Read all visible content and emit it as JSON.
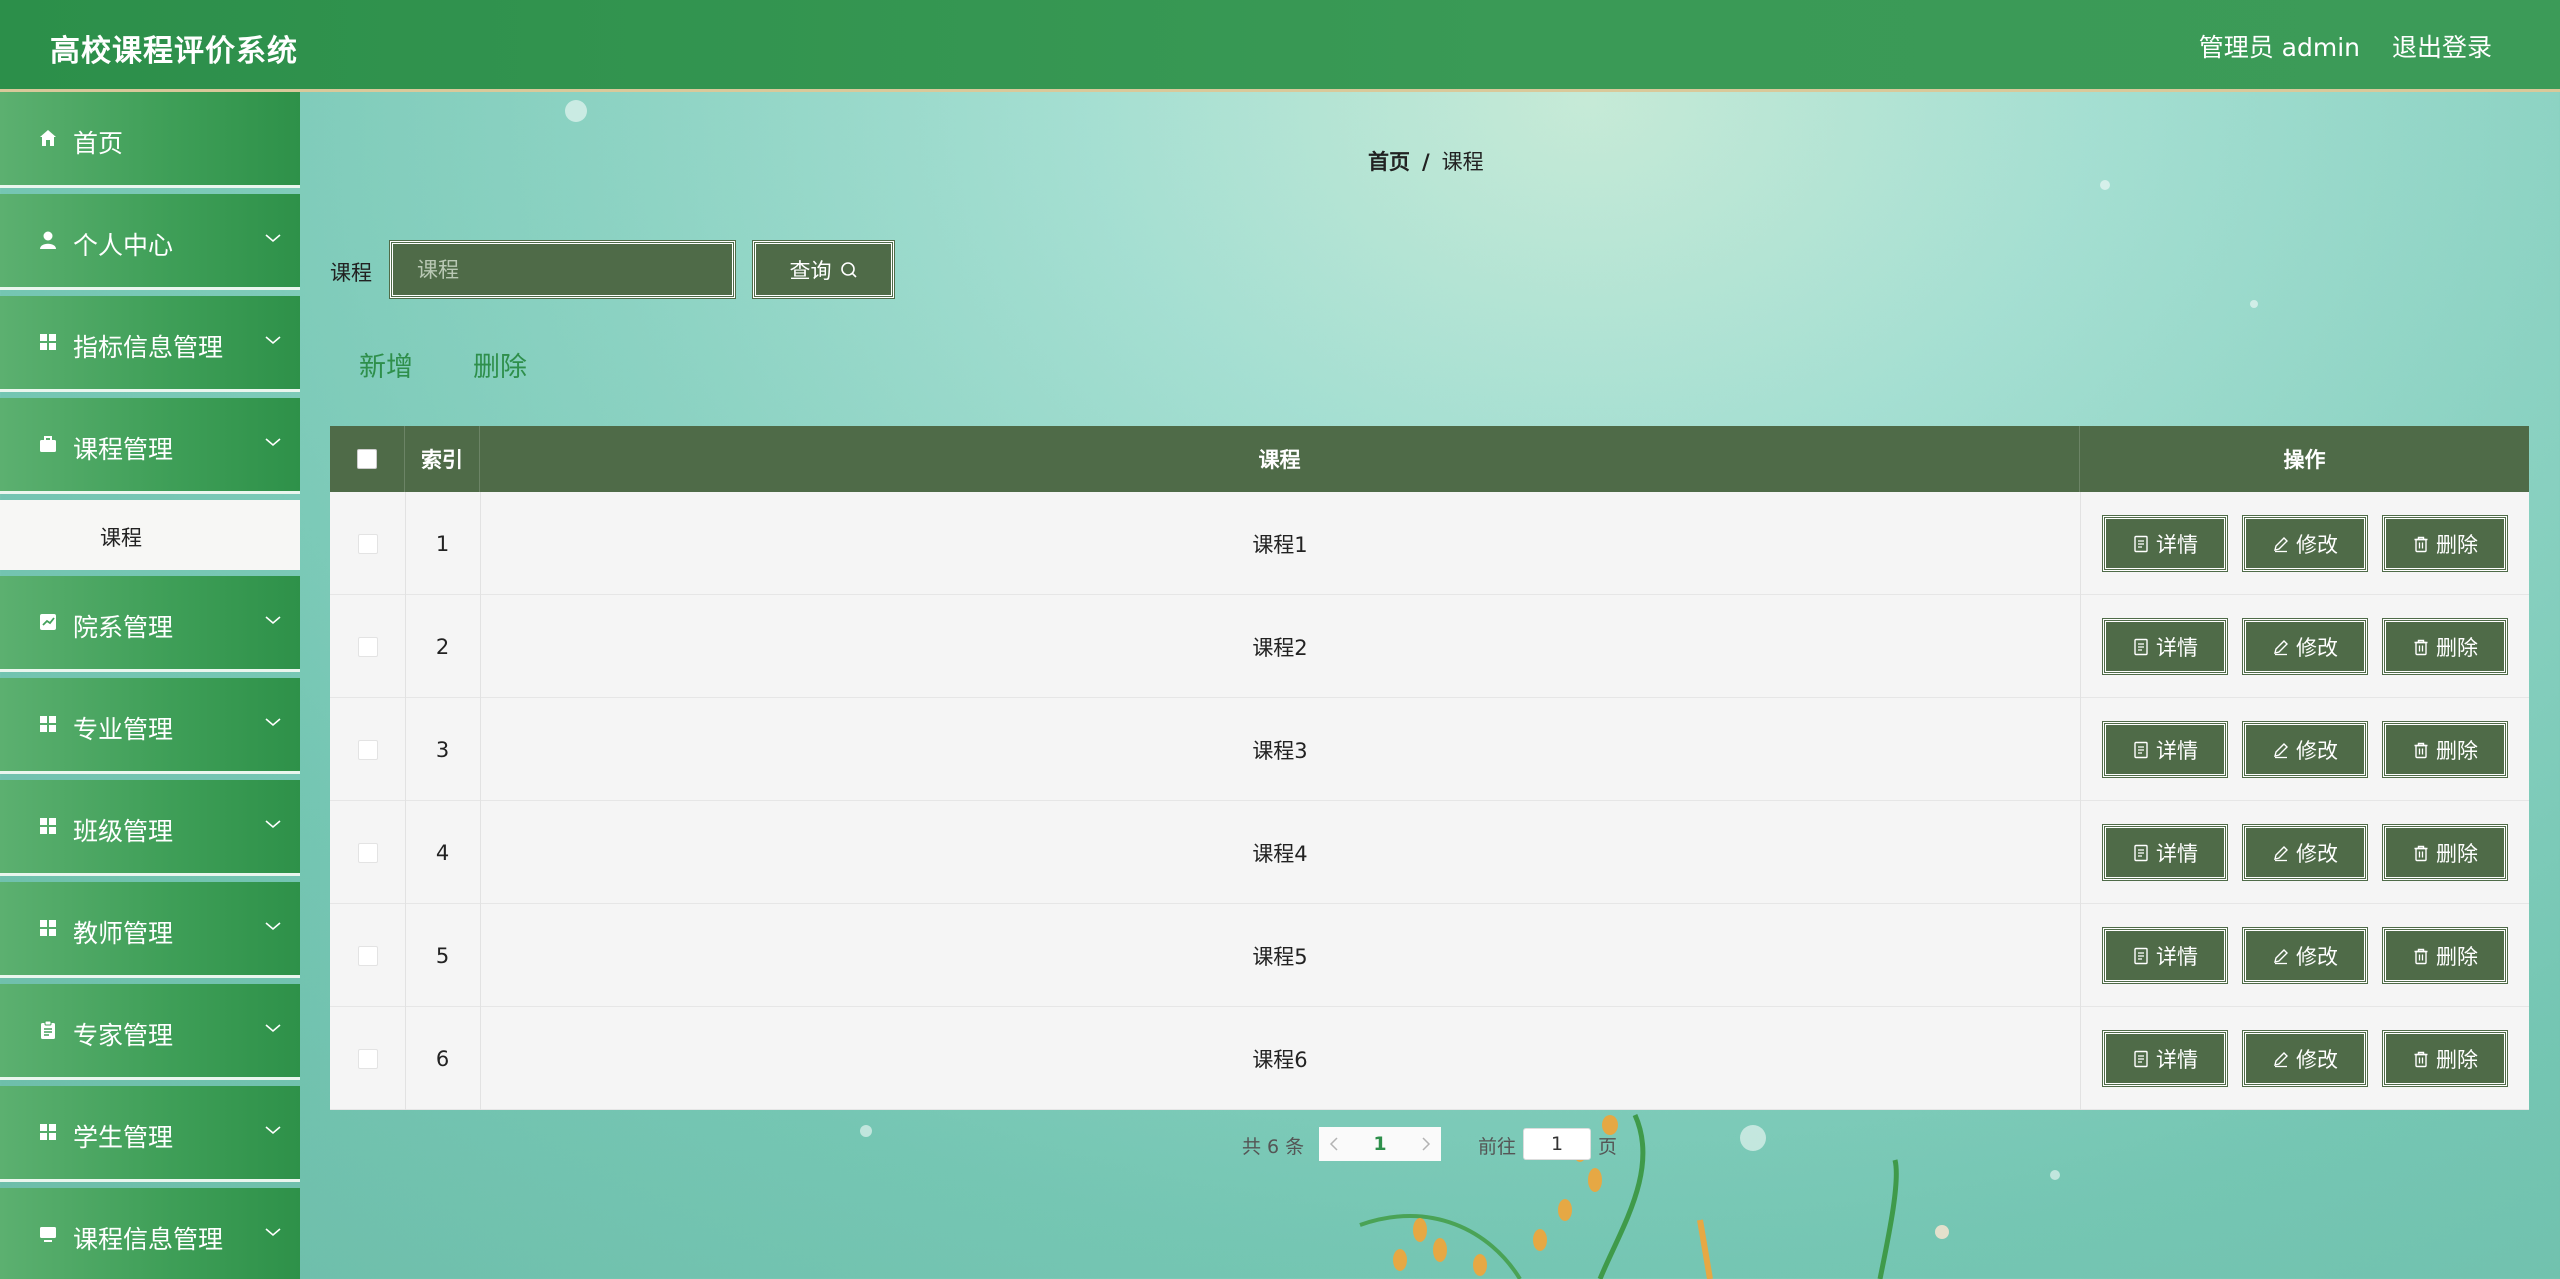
{
  "app": {
    "title": "高校课程评价系统",
    "user": "管理员 admin",
    "logout": "退出登录"
  },
  "sidebar": {
    "items": [
      {
        "label": "首页",
        "icon": "home-icon",
        "has_arrow": false
      },
      {
        "label": "个人中心",
        "icon": "user-icon",
        "has_arrow": true
      },
      {
        "label": "指标信息管理",
        "icon": "grid-icon",
        "has_arrow": true
      },
      {
        "label": "课程管理",
        "icon": "briefcase-icon",
        "has_arrow": true,
        "submenu": "课程"
      },
      {
        "label": "院系管理",
        "icon": "chart-icon",
        "has_arrow": true
      },
      {
        "label": "专业管理",
        "icon": "grid-icon",
        "has_arrow": true
      },
      {
        "label": "班级管理",
        "icon": "grid-icon",
        "has_arrow": true
      },
      {
        "label": "教师管理",
        "icon": "grid-icon",
        "has_arrow": true
      },
      {
        "label": "专家管理",
        "icon": "clipboard-icon",
        "has_arrow": true
      },
      {
        "label": "学生管理",
        "icon": "grid-icon",
        "has_arrow": true
      },
      {
        "label": "课程信息管理",
        "icon": "monitor-icon",
        "has_arrow": true
      }
    ]
  },
  "breadcrumb": {
    "home": "首页",
    "separator": "/",
    "current": "课程"
  },
  "search": {
    "label": "课程",
    "placeholder": "课程",
    "button": "查询"
  },
  "actions": {
    "add": "新增",
    "delete": "删除"
  },
  "table": {
    "headers": {
      "index": "索引",
      "course": "课程",
      "operation": "操作"
    },
    "rows": [
      {
        "index": "1",
        "course": "课程1"
      },
      {
        "index": "2",
        "course": "课程2"
      },
      {
        "index": "3",
        "course": "课程3"
      },
      {
        "index": "4",
        "course": "课程4"
      },
      {
        "index": "5",
        "course": "课程5"
      },
      {
        "index": "6",
        "course": "课程6"
      }
    ],
    "row_buttons": {
      "detail": "详情",
      "edit": "修改",
      "delete": "删除"
    }
  },
  "pagination": {
    "total": "共 6 条",
    "current_page": "1",
    "goto_label": "前往",
    "goto_value": "1",
    "page_suffix": "页"
  },
  "colors": {
    "accent_green": "#2e8f4b",
    "button_dark": "#4f6b48",
    "header_bar": "#3a9a56"
  }
}
